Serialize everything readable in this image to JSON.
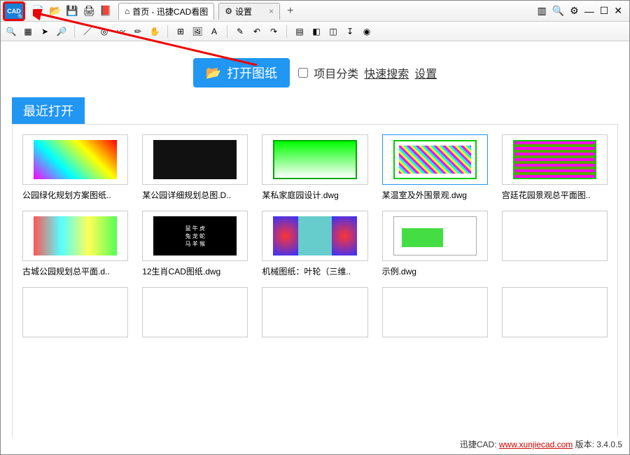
{
  "titlebar": {
    "appIconText": "CAD",
    "tabs": [
      {
        "label": "首页 - 迅捷CAD看图",
        "icon": "home-icon"
      },
      {
        "label": "设置",
        "icon": "gear-icon"
      }
    ],
    "rightIcons": [
      "layers-icon",
      "zoom-icon",
      "gear-icon",
      "minimize-icon",
      "maximize-icon",
      "close-icon"
    ]
  },
  "toolbar1_icons": [
    "new-file-icon",
    "open-folder-icon",
    "save-icon",
    "print-icon",
    "pdf-icon"
  ],
  "toolbar2_icons": [
    "zoom-in-icon",
    "select-marquee-icon",
    "pick-icon",
    "fit-icon",
    "line-icon",
    "circle-target-icon",
    "curve-icon",
    "edit-pencil-icon",
    "pan-icon",
    "grid-icon",
    "image-icon",
    "text-icon",
    "eraser-icon",
    "undo-icon",
    "redo-icon",
    "layer-box-icon",
    "cube-icon",
    "cube-outline-icon",
    "sort-icon",
    "color-wheel-icon"
  ],
  "main": {
    "openButton": "打开图纸",
    "checkbox_label": "项目分类",
    "link_search": "快速搜索",
    "link_settings": "设置",
    "section_header": "最近打开"
  },
  "files": [
    {
      "name": "公园绿化规划方案图纸..",
      "art": "a1",
      "sel": false
    },
    {
      "name": "某公园详细规划总图.D..",
      "art": "a2",
      "sel": false
    },
    {
      "name": "某私家庭园设计.dwg",
      "art": "a3",
      "sel": false
    },
    {
      "name": "某温室及外围景观.dwg",
      "art": "a4",
      "sel": true
    },
    {
      "name": "宫廷花园景观总平面图..",
      "art": "a5",
      "sel": false
    },
    {
      "name": "古城公园规划总平面.d..",
      "art": "a6",
      "sel": false
    },
    {
      "name": "12生肖CAD图纸.dwg",
      "art": "a7",
      "sel": false
    },
    {
      "name": "机械图纸：叶轮（三维..",
      "art": "a8",
      "sel": false
    },
    {
      "name": "示例.dwg",
      "art": "a9",
      "sel": false
    },
    {
      "name": "",
      "art": "",
      "sel": false
    },
    {
      "name": "",
      "art": "",
      "sel": false
    },
    {
      "name": "",
      "art": "",
      "sel": false
    },
    {
      "name": "",
      "art": "",
      "sel": false
    },
    {
      "name": "",
      "art": "",
      "sel": false
    },
    {
      "name": "",
      "art": "",
      "sel": false
    }
  ],
  "footer": {
    "brand": "迅捷CAD:",
    "url_text": "www.xunjiecad.com",
    "version_label": "版本:",
    "version": "3.4.0.5"
  },
  "icon_glyphs": {
    "new-file-icon": "📄",
    "open-folder-icon": "📂",
    "save-icon": "💾",
    "print-icon": "🖨",
    "pdf-icon": "📕",
    "zoom-in-icon": "🔍",
    "select-marquee-icon": "▦",
    "pick-icon": "➤",
    "fit-icon": "🔎",
    "line-icon": "／",
    "circle-target-icon": "◎",
    "curve-icon": "〰",
    "edit-pencil-icon": "✏",
    "pan-icon": "✋",
    "grid-icon": "⊞",
    "image-icon": "🖼",
    "text-icon": "A",
    "eraser-icon": "✎",
    "undo-icon": "↶",
    "redo-icon": "↷",
    "layer-box-icon": "▤",
    "cube-icon": "◧",
    "cube-outline-icon": "◫",
    "sort-icon": "↧",
    "color-wheel-icon": "◉",
    "home-icon": "⌂",
    "gear-icon": "⚙",
    "layers-icon": "▥",
    "zoom-icon": "🔍",
    "minimize-icon": "—",
    "maximize-icon": "☐",
    "close-icon": "✕"
  }
}
